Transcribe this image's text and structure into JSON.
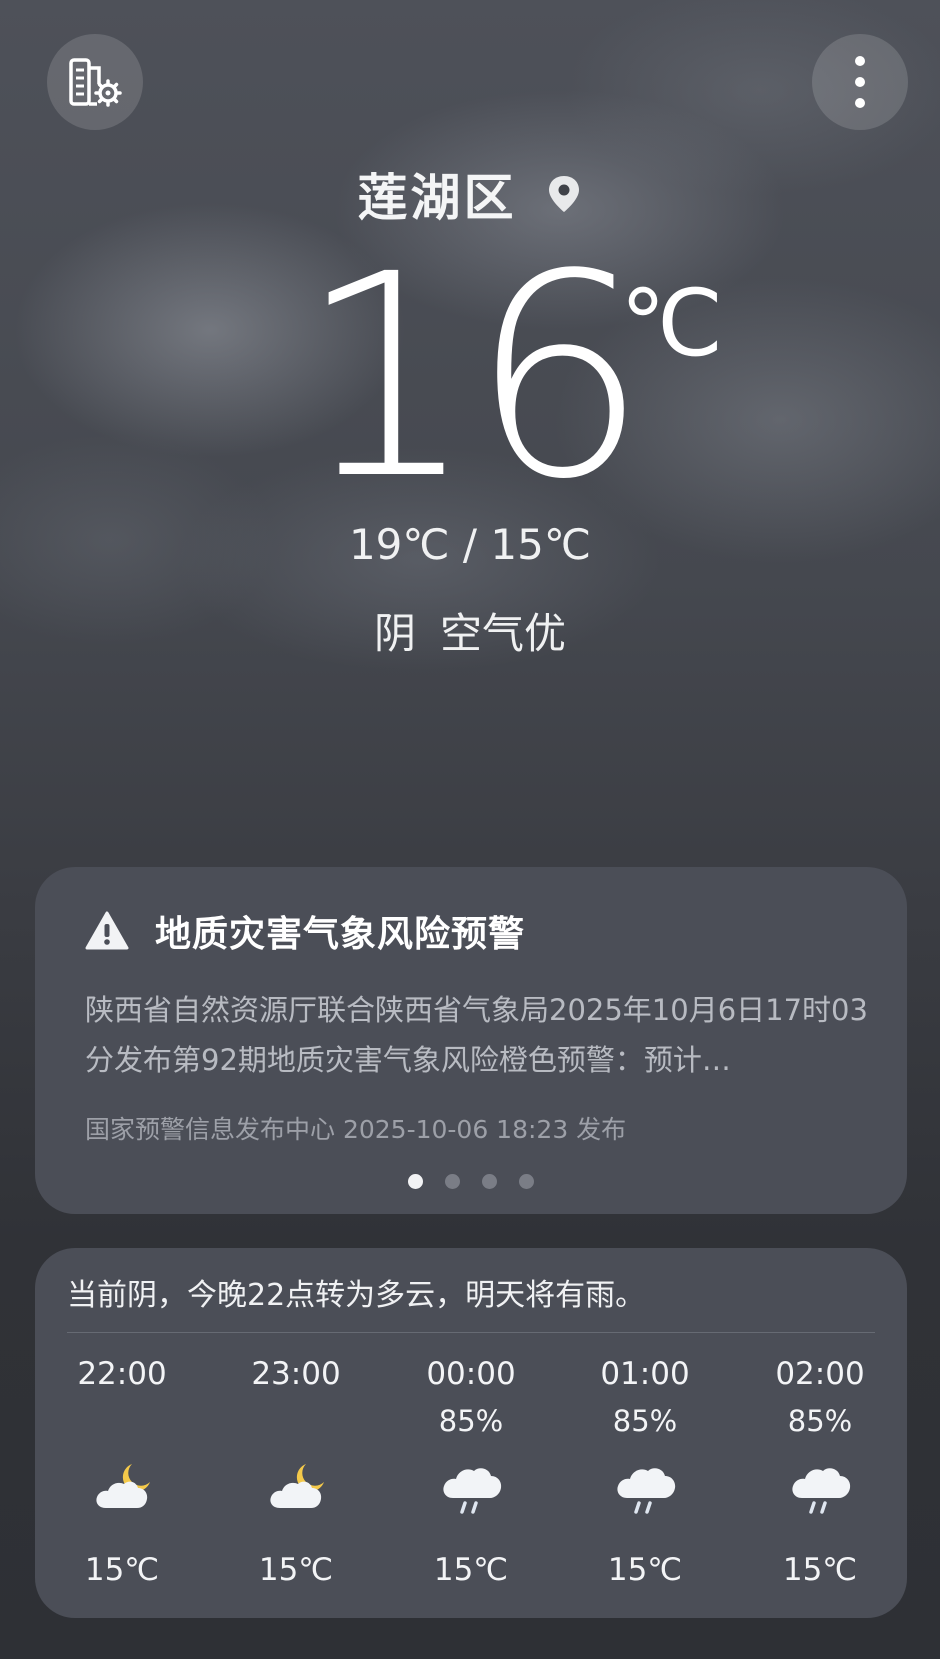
{
  "header": {
    "city_manager_icon": "city-settings-icon",
    "more_icon": "more-vertical-icon"
  },
  "location": {
    "name": "莲湖区",
    "icon": "location-pin-icon"
  },
  "current": {
    "temperature": "16",
    "unit": "℃",
    "range": "19℃ / 15℃",
    "condition": "阴",
    "air_quality": "空气优"
  },
  "alert": {
    "icon": "warning-triangle-icon",
    "title": "地质灾害气象风险预警",
    "body": "陕西省自然资源厅联合陕西省气象局2025年10月6日17时03分发布第92期地质灾害气象风险橙色预警：预计…",
    "source": "国家预警信息发布中心 2025-10-06 18:23 发布",
    "pages": 4,
    "active_page": 1
  },
  "forecast": {
    "summary": "当前阴，今晚22点转为多云，明天将有雨。",
    "hours": [
      {
        "time": "22:00",
        "precip": "",
        "icon": "partly-cloudy-night-icon",
        "temp": "15℃"
      },
      {
        "time": "23:00",
        "precip": "",
        "icon": "partly-cloudy-night-icon",
        "temp": "15℃"
      },
      {
        "time": "00:00",
        "precip": "85%",
        "icon": "light-rain-icon",
        "temp": "15℃"
      },
      {
        "time": "01:00",
        "precip": "85%",
        "icon": "light-rain-icon",
        "temp": "15℃"
      },
      {
        "time": "02:00",
        "precip": "85%",
        "icon": "light-rain-icon",
        "temp": "15℃"
      }
    ]
  },
  "colors": {
    "background": "#3a3c42",
    "card": "#4b4e57",
    "moon": "#f4c94a",
    "cloud": "#f2f4f7",
    "rain": "#dfe6f0"
  }
}
